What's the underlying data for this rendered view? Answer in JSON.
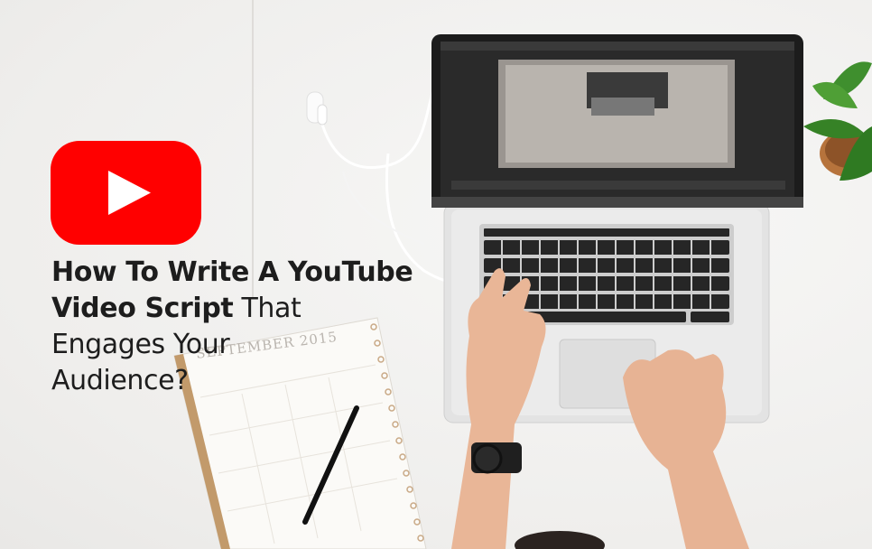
{
  "headline": {
    "line1_bold": "How To Write A YouTube",
    "line2_bold": "Video Script",
    "line2_light": " That",
    "line3": "Engages Your",
    "line4": "Audience?"
  },
  "calendar": {
    "month": "SEPTEMBER 2015"
  },
  "colors": {
    "youtube_red": "#ff0000",
    "text": "#1d1d1d",
    "background": "#f1f0ee"
  },
  "icons": [
    "youtube-play-icon"
  ]
}
